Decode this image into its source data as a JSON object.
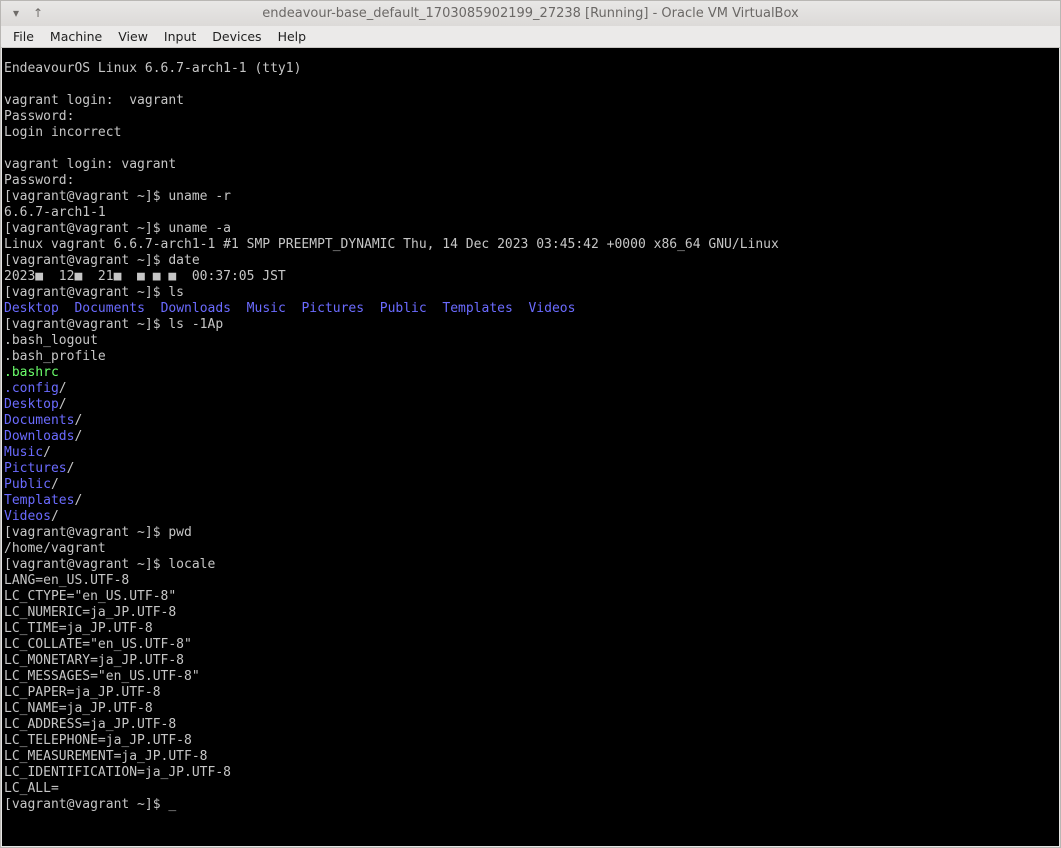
{
  "window": {
    "title": "endeavour-base_default_1703085902199_27238 [Running] - Oracle VM VirtualBox",
    "collapse_icon": "chevron-down-icon",
    "pin_icon": "pin-icon"
  },
  "menu": [
    "File",
    "Machine",
    "View",
    "Input",
    "Devices",
    "Help"
  ],
  "console": {
    "lines": [
      {
        "segments": [
          {
            "text": "EndeavourOS Linux 6.6.7-arch1-1 (tty1)"
          }
        ]
      },
      {
        "segments": [
          {
            "text": ""
          }
        ]
      },
      {
        "segments": [
          {
            "text": "vagrant login:  vagrant"
          }
        ]
      },
      {
        "segments": [
          {
            "text": "Password:"
          }
        ]
      },
      {
        "segments": [
          {
            "text": "Login incorrect"
          }
        ]
      },
      {
        "segments": [
          {
            "text": ""
          }
        ]
      },
      {
        "segments": [
          {
            "text": "vagrant login: vagrant"
          }
        ]
      },
      {
        "segments": [
          {
            "text": "Password:"
          }
        ]
      },
      {
        "segments": [
          {
            "text": "[vagrant@vagrant ~]$ uname -r"
          }
        ]
      },
      {
        "segments": [
          {
            "text": "6.6.7-arch1-1"
          }
        ]
      },
      {
        "segments": [
          {
            "text": "[vagrant@vagrant ~]$ uname -a"
          }
        ]
      },
      {
        "segments": [
          {
            "text": "Linux vagrant 6.6.7-arch1-1 #1 SMP PREEMPT_DYNAMIC Thu, 14 Dec 2023 03:45:42 +0000 x86_64 GNU/Linux"
          }
        ]
      },
      {
        "segments": [
          {
            "text": "[vagrant@vagrant ~]$ date"
          }
        ]
      },
      {
        "segments": [
          {
            "text": "2023■  12■  21■  ■ ■ ■  00:37:05 JST"
          }
        ]
      },
      {
        "segments": [
          {
            "text": "[vagrant@vagrant ~]$ ls"
          }
        ]
      },
      {
        "segments": [
          {
            "text": "Desktop",
            "cls": "dir"
          },
          {
            "text": "  "
          },
          {
            "text": "Documents",
            "cls": "dir"
          },
          {
            "text": "  "
          },
          {
            "text": "Downloads",
            "cls": "dir"
          },
          {
            "text": "  "
          },
          {
            "text": "Music",
            "cls": "dir"
          },
          {
            "text": "  "
          },
          {
            "text": "Pictures",
            "cls": "dir"
          },
          {
            "text": "  "
          },
          {
            "text": "Public",
            "cls": "dir"
          },
          {
            "text": "  "
          },
          {
            "text": "Templates",
            "cls": "dir"
          },
          {
            "text": "  "
          },
          {
            "text": "Videos",
            "cls": "dir"
          }
        ]
      },
      {
        "segments": [
          {
            "text": "[vagrant@vagrant ~]$ ls -1Ap"
          }
        ]
      },
      {
        "segments": [
          {
            "text": ".bash_logout"
          }
        ]
      },
      {
        "segments": [
          {
            "text": ".bash_profile"
          }
        ]
      },
      {
        "segments": [
          {
            "text": ".bashrc",
            "cls": "exe"
          }
        ]
      },
      {
        "segments": [
          {
            "text": ".config",
            "cls": "dir"
          },
          {
            "text": "/"
          }
        ]
      },
      {
        "segments": [
          {
            "text": "Desktop",
            "cls": "dir"
          },
          {
            "text": "/"
          }
        ]
      },
      {
        "segments": [
          {
            "text": "Documents",
            "cls": "dir"
          },
          {
            "text": "/"
          }
        ]
      },
      {
        "segments": [
          {
            "text": "Downloads",
            "cls": "dir"
          },
          {
            "text": "/"
          }
        ]
      },
      {
        "segments": [
          {
            "text": "Music",
            "cls": "dir"
          },
          {
            "text": "/"
          }
        ]
      },
      {
        "segments": [
          {
            "text": "Pictures",
            "cls": "dir"
          },
          {
            "text": "/"
          }
        ]
      },
      {
        "segments": [
          {
            "text": "Public",
            "cls": "dir"
          },
          {
            "text": "/"
          }
        ]
      },
      {
        "segments": [
          {
            "text": "Templates",
            "cls": "dir"
          },
          {
            "text": "/"
          }
        ]
      },
      {
        "segments": [
          {
            "text": "Videos",
            "cls": "dir"
          },
          {
            "text": "/"
          }
        ]
      },
      {
        "segments": [
          {
            "text": "[vagrant@vagrant ~]$ pwd"
          }
        ]
      },
      {
        "segments": [
          {
            "text": "/home/vagrant"
          }
        ]
      },
      {
        "segments": [
          {
            "text": "[vagrant@vagrant ~]$ locale"
          }
        ]
      },
      {
        "segments": [
          {
            "text": "LANG=en_US.UTF-8"
          }
        ]
      },
      {
        "segments": [
          {
            "text": "LC_CTYPE=\"en_US.UTF-8\""
          }
        ]
      },
      {
        "segments": [
          {
            "text": "LC_NUMERIC=ja_JP.UTF-8"
          }
        ]
      },
      {
        "segments": [
          {
            "text": "LC_TIME=ja_JP.UTF-8"
          }
        ]
      },
      {
        "segments": [
          {
            "text": "LC_COLLATE=\"en_US.UTF-8\""
          }
        ]
      },
      {
        "segments": [
          {
            "text": "LC_MONETARY=ja_JP.UTF-8"
          }
        ]
      },
      {
        "segments": [
          {
            "text": "LC_MESSAGES=\"en_US.UTF-8\""
          }
        ]
      },
      {
        "segments": [
          {
            "text": "LC_PAPER=ja_JP.UTF-8"
          }
        ]
      },
      {
        "segments": [
          {
            "text": "LC_NAME=ja_JP.UTF-8"
          }
        ]
      },
      {
        "segments": [
          {
            "text": "LC_ADDRESS=ja_JP.UTF-8"
          }
        ]
      },
      {
        "segments": [
          {
            "text": "LC_TELEPHONE=ja_JP.UTF-8"
          }
        ]
      },
      {
        "segments": [
          {
            "text": "LC_MEASUREMENT=ja_JP.UTF-8"
          }
        ]
      },
      {
        "segments": [
          {
            "text": "LC_IDENTIFICATION=ja_JP.UTF-8"
          }
        ]
      },
      {
        "segments": [
          {
            "text": "LC_ALL="
          }
        ]
      },
      {
        "segments": [
          {
            "text": "[vagrant@vagrant ~]$ "
          },
          {
            "text": "_",
            "cls": "cursor"
          }
        ]
      }
    ]
  },
  "colors": {
    "console_bg": "#000000",
    "console_fg": "#c6c6c6",
    "directory": "#6b6bff",
    "executable": "#6bff6b"
  }
}
